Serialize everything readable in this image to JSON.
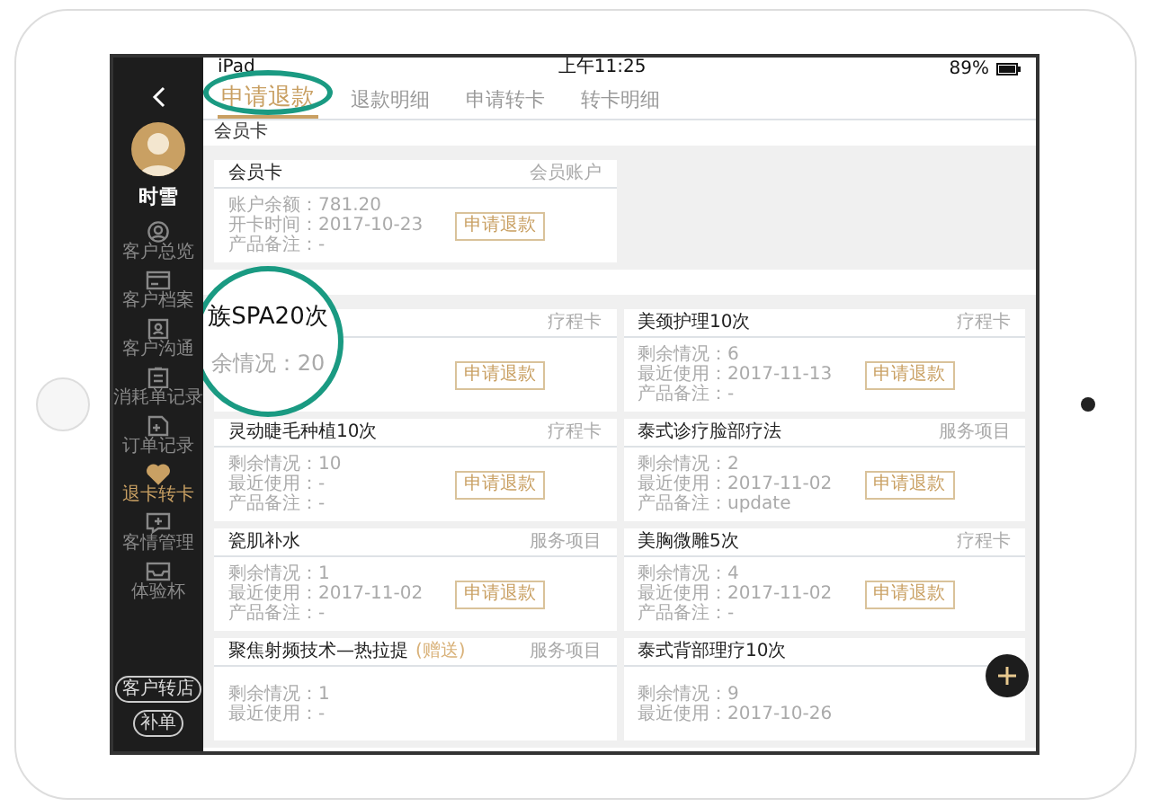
{
  "status_bar": {
    "device": "iPad",
    "time": "上午11:25",
    "battery": "89%"
  },
  "sidebar": {
    "name": "时雪",
    "items": [
      {
        "label": "客户总览",
        "selected": false
      },
      {
        "label": "客户档案",
        "selected": false
      },
      {
        "label": "客户沟通",
        "selected": false
      },
      {
        "label": "消耗单记录",
        "selected": false
      },
      {
        "label": "订单记录",
        "selected": false
      },
      {
        "label": "退卡转卡",
        "selected": true
      },
      {
        "label": "客情管理",
        "selected": false
      },
      {
        "label": "体验杯",
        "selected": false
      }
    ],
    "buttons": [
      "客户转店",
      "补单"
    ]
  },
  "tabs": [
    {
      "label": "申请退款",
      "selected": true,
      "circled": true
    },
    {
      "label": "退款明细",
      "selected": false,
      "circled": false
    },
    {
      "label": "申请转卡",
      "selected": false,
      "circled": false
    },
    {
      "label": "转卡明细",
      "selected": false,
      "circled": false
    }
  ],
  "sections": [
    {
      "label": "会员卡",
      "cards": [
        {
          "title": "会员卡",
          "type": "会员账户",
          "lines": [
            "账户余额：781.20",
            "开卡时间：2017-10-23",
            "产品备注：-"
          ],
          "button": "申请退款"
        }
      ]
    },
    {
      "cards": [
        {
          "lens": {
            "title": "族SPA20次",
            "line": "余情况：20"
          },
          "type": "疗程卡",
          "button": "申请退款"
        },
        {
          "title": "美颈护理10次",
          "type": "疗程卡",
          "lines": [
            "剩余情况：6",
            "最近使用：2017-11-13",
            "产品备注：-"
          ],
          "button": "申请退款"
        },
        {
          "title": "灵动睫毛种植10次",
          "type": "疗程卡",
          "lines": [
            "剩余情况：10",
            "最近使用：-",
            "产品备注：-"
          ],
          "button": "申请退款"
        },
        {
          "title": "泰式诊疗脸部疗法",
          "type": "服务项目",
          "lines": [
            "剩余情况：2",
            "最近使用：2017-11-02",
            "产品备注：update"
          ],
          "button": "申请退款"
        },
        {
          "title": "瓷肌补水",
          "type": "服务项目",
          "lines": [
            "剩余情况：1",
            "最近使用：2017-11-02",
            "产品备注：-"
          ],
          "button": "申请退款"
        },
        {
          "title": "美胸微雕5次",
          "type": "疗程卡",
          "lines": [
            "剩余情况：4",
            "最近使用：2017-11-02",
            "产品备注：-"
          ],
          "button": "申请退款"
        },
        {
          "title": "聚焦射频技术—热拉提",
          "tag": "(赠送)",
          "type": "服务项目",
          "lines": [
            "剩余情况：1",
            "最近使用：-"
          ]
        },
        {
          "title": "泰式背部理疗10次",
          "lines": [
            "剩余情况：9",
            "最近使用：2017-10-26"
          ]
        }
      ]
    }
  ]
}
